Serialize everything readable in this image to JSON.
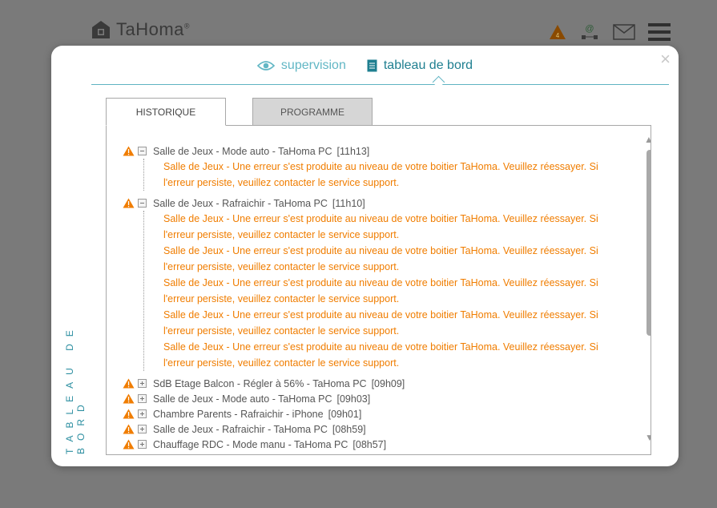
{
  "app": {
    "logo_text": "TaHoma",
    "logo_reg": "®",
    "alert_count": "4"
  },
  "modal": {
    "close_glyph": "×",
    "tabs": [
      {
        "label": "supervision",
        "icon": "eye-icon"
      },
      {
        "label": "tableau de bord",
        "icon": "document-icon"
      }
    ],
    "vertical_label": "TABLEAU DE BORD"
  },
  "panel": {
    "tabs": {
      "history": "HISTORIQUE",
      "program": "PROGRAMME"
    },
    "entries": [
      {
        "title": "Salle de Jeux - Mode auto - TaHoma PC",
        "time": "[11h13]",
        "expanded": true,
        "messages": [
          "Salle de Jeux - Une erreur s'est produite au niveau de votre boitier TaHoma. Veuillez réessayer. Si l'erreur persiste, veuillez contacter le service support."
        ]
      },
      {
        "title": "Salle de Jeux - Rafraichir - TaHoma PC",
        "time": "[11h10]",
        "expanded": true,
        "messages": [
          "Salle de Jeux - Une erreur s'est produite au niveau de votre boitier TaHoma. Veuillez réessayer. Si l'erreur persiste, veuillez contacter le service support.",
          "Salle de Jeux - Une erreur s'est produite au niveau de votre boitier TaHoma. Veuillez réessayer. Si l'erreur persiste, veuillez contacter le service support.",
          "Salle de Jeux - Une erreur s'est produite au niveau de votre boitier TaHoma. Veuillez réessayer. Si l'erreur persiste, veuillez contacter le service support.",
          "Salle de Jeux - Une erreur s'est produite au niveau de votre boitier TaHoma. Veuillez réessayer. Si l'erreur persiste, veuillez contacter le service support.",
          "Salle de Jeux - Une erreur s'est produite au niveau de votre boitier TaHoma. Veuillez réessayer. Si l'erreur persiste, veuillez contacter le service support."
        ]
      },
      {
        "title": "SdB Etage Balcon - Régler à 56% - TaHoma PC",
        "time": "[09h09]",
        "expanded": false,
        "messages": []
      },
      {
        "title": "Salle de Jeux - Mode auto - TaHoma PC",
        "time": "[09h03]",
        "expanded": false,
        "messages": []
      },
      {
        "title": "Chambre Parents - Rafraichir - iPhone",
        "time": "[09h01]",
        "expanded": false,
        "messages": []
      },
      {
        "title": "Salle de Jeux - Rafraichir - TaHoma PC",
        "time": "[08h59]",
        "expanded": false,
        "messages": []
      },
      {
        "title": "Chauffage RDC - Mode manu - TaHoma PC",
        "time": "[08h57]",
        "expanded": false,
        "messages": []
      }
    ]
  },
  "colors": {
    "accent": "#1f7f90",
    "warning": "#f07d00",
    "overlay": "#7a7a7a"
  }
}
